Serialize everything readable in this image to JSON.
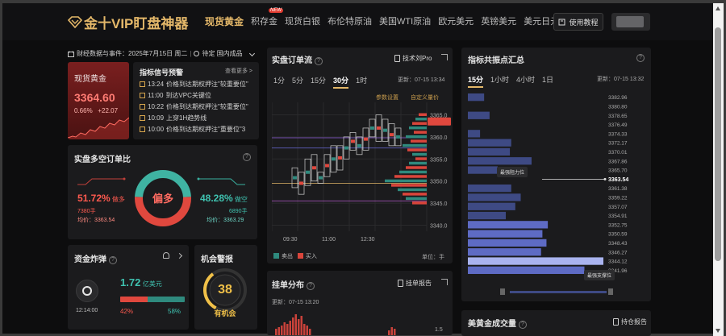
{
  "header": {
    "logo": "金十VIP盯盘神器",
    "nav": [
      {
        "label": "现货黄金",
        "active": true
      },
      {
        "label": "积存金",
        "badge": "NEW"
      },
      {
        "label": "现货白银"
      },
      {
        "label": "布伦特原油"
      },
      {
        "label": "美国WTI原油"
      },
      {
        "label": "欧元美元"
      },
      {
        "label": "英镑美元"
      },
      {
        "label": "美元日元"
      },
      {
        "label": "美"
      }
    ],
    "tutorial_label": "使用教程"
  },
  "calendar": {
    "text": "财经数据与事件：2025年7月15日 周二",
    "pending": "待定 国内成品"
  },
  "gold_card": {
    "name": "现货黄金",
    "price": "3364.60",
    "change_pct": "0.66%",
    "change": "+22.07"
  },
  "signal": {
    "title": "指标信号预警",
    "more": "查看更多 >",
    "items": [
      {
        "time": "13:24",
        "text": "价格到达期权押注\"较重要位\""
      },
      {
        "time": "11:00",
        "text": "到达VPC关键位"
      },
      {
        "time": "10:22",
        "text": "价格到达期权押注\"较重要位\""
      },
      {
        "time": "10:09",
        "text": "上穿1H趋势线"
      },
      {
        "time": "10:00",
        "text": "价格到达期权押注\"重要位\"3"
      }
    ]
  },
  "long_short": {
    "title": "实盘多空订单比",
    "long_pct": "51.72",
    "long_label": "做多",
    "long_hands": "7380手",
    "long_avg": "均价：3363.54",
    "short_pct": "48.28",
    "short_label": "做空",
    "short_hands": "6890手",
    "short_avg": "均价：3363.29",
    "center_label": "偏多",
    "long_fraction": 0.5172
  },
  "bomb": {
    "title": "资金炸弹",
    "amount": "1.72",
    "unit": "亿美元",
    "time": "12:14:00",
    "left_pct": "42%",
    "right_pct": "58%",
    "left_fraction": 0.42
  },
  "alert": {
    "title": "机会警报",
    "score": "38",
    "label": "有机会",
    "score_fraction": 0.38
  },
  "order_flow": {
    "title": "实盘订单流",
    "tech_btn": "技术刘Pro",
    "tabs": [
      {
        "label": "1分"
      },
      {
        "label": "5分"
      },
      {
        "label": "15分"
      },
      {
        "label": "30分",
        "active": true
      },
      {
        "label": "1时"
      }
    ],
    "updated": "更新：07-15 13:34",
    "param": "参数设置",
    "custom": "自定义量价",
    "y_ticks": [
      "3365.0",
      "3360.0",
      "3355.0",
      "3350.0",
      "3345.0",
      "3340.0"
    ],
    "x_ticks": [
      "09:30",
      "11:00",
      "12:30"
    ],
    "legend_sell": "卖出",
    "legend_buy": "买入",
    "unit": "单位：手",
    "colors": {
      "sell": "#2f8a7e",
      "buy": "#d9453b"
    }
  },
  "distribution": {
    "title": "挂单分布",
    "report_btn": "挂单报告",
    "updated": "更新：07-15 13:20",
    "y_tick": "1.5"
  },
  "resonance": {
    "title": "指标共振点汇总",
    "tabs": [
      {
        "label": "15分",
        "active": true
      },
      {
        "label": "1小时"
      },
      {
        "label": "4小时"
      },
      {
        "label": "1日"
      }
    ],
    "updated": "更新：07-15 13:32",
    "levels": [
      {
        "price": "3382.96",
        "strength": 0.12
      },
      {
        "price": "3380.80",
        "strength": 0.0
      },
      {
        "price": "3378.65",
        "strength": 0.16
      },
      {
        "price": "3376.49",
        "strength": 0.0
      },
      {
        "price": "3374.33",
        "strength": 0.09
      },
      {
        "price": "3372.17",
        "strength": 0.32
      },
      {
        "price": "3370.01",
        "strength": 0.31
      },
      {
        "price": "3367.86",
        "strength": 0.47
      },
      {
        "price": "3365.70",
        "strength": 0.22
      },
      {
        "price": "3363.54",
        "strength": 0.0,
        "current": true
      },
      {
        "price": "3361.38",
        "strength": 0.32
      },
      {
        "price": "3359.22",
        "strength": 0.39
      },
      {
        "price": "3357.07",
        "strength": 0.35
      },
      {
        "price": "3354.91",
        "strength": 0.28
      },
      {
        "price": "3352.75",
        "strength": 0.59
      },
      {
        "price": "3350.59",
        "strength": 0.55
      },
      {
        "price": "3348.43",
        "strength": 0.58
      },
      {
        "price": "3346.27",
        "strength": 0.54
      },
      {
        "price": "3344.12",
        "strength": 1.0
      },
      {
        "price": "3341.96",
        "strength": 0.86
      }
    ],
    "resistance_label": "最强阻力位",
    "support_label": "最强支撑位"
  },
  "metals": {
    "title": "美黄金成交量",
    "report_btn": "持仓报告"
  }
}
